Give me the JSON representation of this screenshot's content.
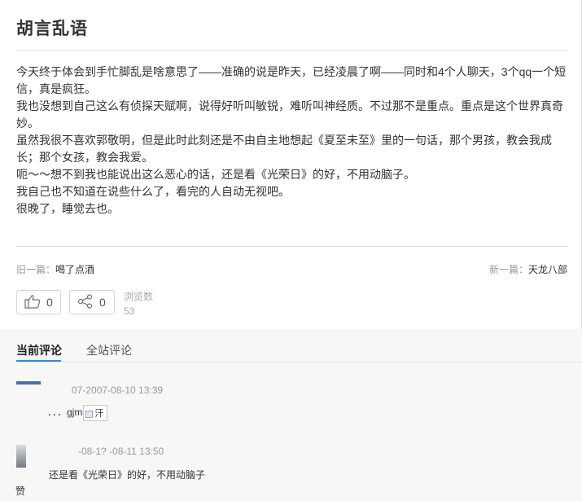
{
  "post": {
    "title": "胡言乱语",
    "paragraphs": [
      "今天终于体会到手忙脚乱是啥意思了——准确的说是昨天，已经凌晨了啊——同时和4个人聊天，3个qq一个短信，真是疯狂。",
      "我也没想到自己这么有侦探天赋啊，说得好听叫敏锐，难听叫神经质。不过那不是重点。重点是这个世界真奇妙。",
      "虽然我很不喜欢郭敬明，但是此时此刻还是不由自主地想起《夏至未至》里的一句话，那个男孩，教会我成长；那个女孩，教会我爱。",
      "呃～～想不到我也能说出这么恶心的话，还是看《光荣日》的好，不用动脑子。",
      "我自己也不知道在说些什么了，看完的人自动无视吧。",
      "很晚了，睡觉去也。"
    ]
  },
  "nav": {
    "prev_prefix": "旧一篇：",
    "prev_title": "喝了点酒",
    "next_prefix": "新一篇：",
    "next_title": "天龙八部"
  },
  "actions": {
    "like_count": "0",
    "share_count": "0",
    "views_label": "浏览数",
    "views_count": "53"
  },
  "comments": {
    "tab_current": "当前评论",
    "tab_site": "全站评论",
    "items": [
      {
        "time": "07-2007-08-10 13:39",
        "text": "．．．gjm",
        "image_alt": "汗"
      },
      {
        "time": "-08-1? -08-11 13:50",
        "text": "还是看《光荣日》的好，不用动脑子",
        "avatar_label": "赞"
      }
    ]
  },
  "colors": {
    "accent": "#2f8be0",
    "muted_text": "#999999",
    "comment_bg": "#f7f7f7"
  }
}
